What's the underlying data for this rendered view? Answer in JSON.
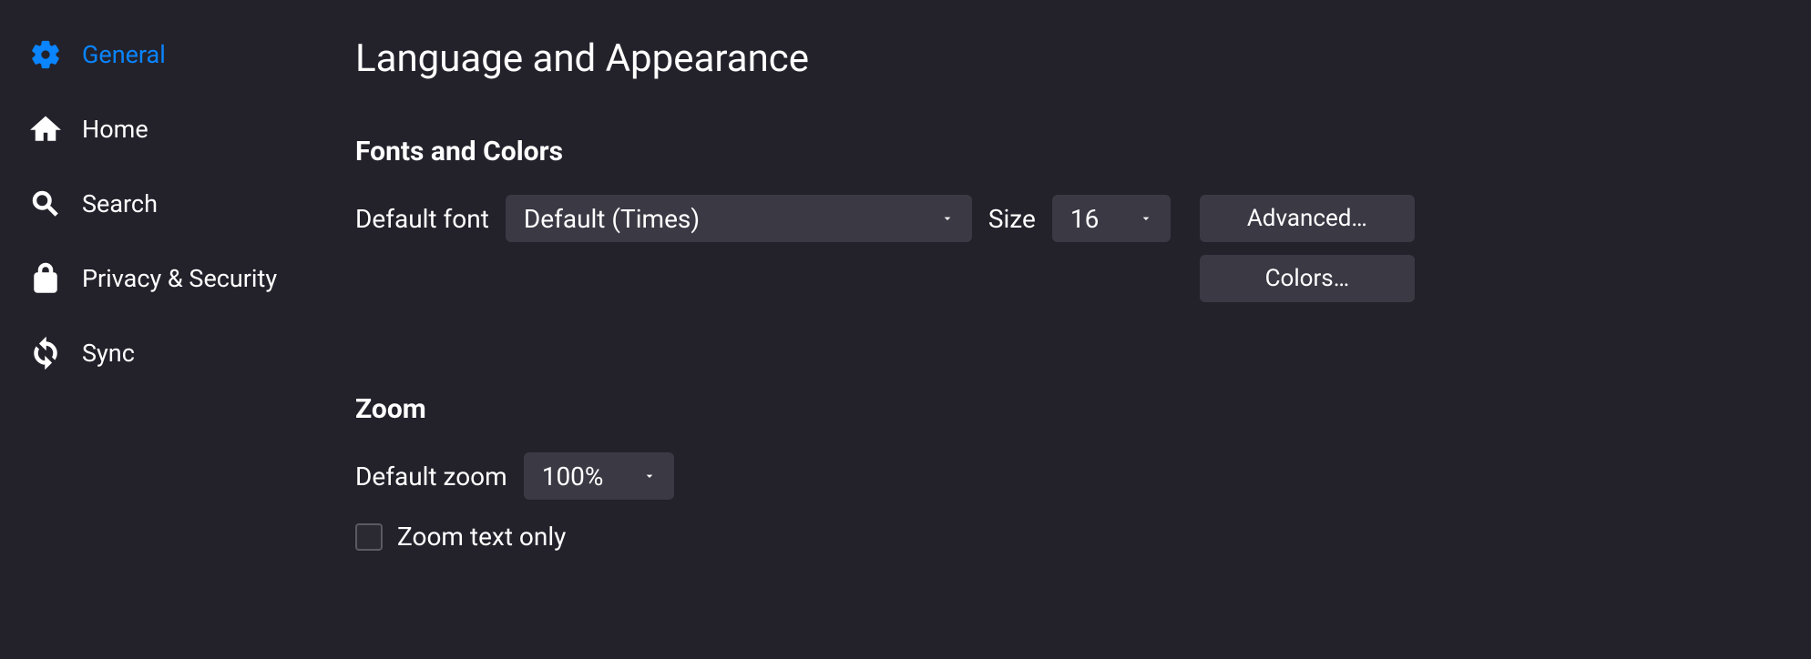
{
  "sidebar": {
    "items": [
      {
        "label": "General",
        "active": true
      },
      {
        "label": "Home",
        "active": false
      },
      {
        "label": "Search",
        "active": false
      },
      {
        "label": "Privacy & Security",
        "active": false
      },
      {
        "label": "Sync",
        "active": false
      }
    ]
  },
  "main": {
    "title": "Language and Appearance",
    "fonts_colors": {
      "heading": "Fonts and Colors",
      "default_font_label": "Default font",
      "default_font_value": "Default (Times)",
      "size_label": "Size",
      "size_value": "16",
      "advanced_button": "Advanced…",
      "colors_button": "Colors…"
    },
    "zoom": {
      "heading": "Zoom",
      "default_zoom_label": "Default zoom",
      "default_zoom_value": "100%",
      "zoom_text_only_label": "Zoom text only",
      "zoom_text_only_checked": false
    }
  },
  "colors": {
    "accent": "#0a84ff",
    "background": "#23222b",
    "control": "#3a3944"
  }
}
